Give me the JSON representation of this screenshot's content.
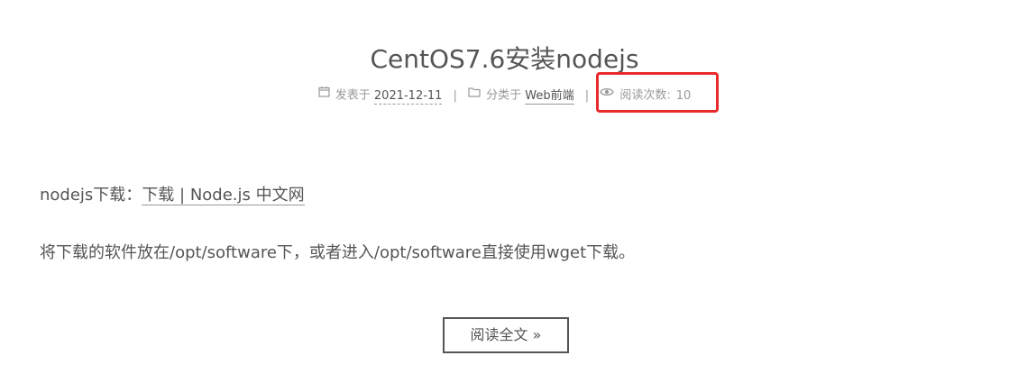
{
  "post": {
    "title": "CentOS7.6安装nodejs",
    "meta": {
      "posted_label": "发表于",
      "posted_date": "2021-12-11",
      "separator": "|",
      "category_label": "分类于",
      "category": "Web前端",
      "views_label": "阅读次数:",
      "views_count": "10"
    },
    "body": {
      "download_prefix": "nodejs下载：",
      "download_link": "下载 | Node.js 中文网",
      "paragraph2": "将下载的软件放在/opt/software下，或者进入/opt/software直接使用wget下载。"
    },
    "read_more": "阅读全文 »"
  },
  "icons": {
    "calendar": "calendar-icon",
    "folder": "folder-icon",
    "eye": "eye-icon"
  },
  "colors": {
    "text": "#555555",
    "meta": "#999999",
    "highlight": "#e82a2a",
    "background": "#ffffff"
  }
}
